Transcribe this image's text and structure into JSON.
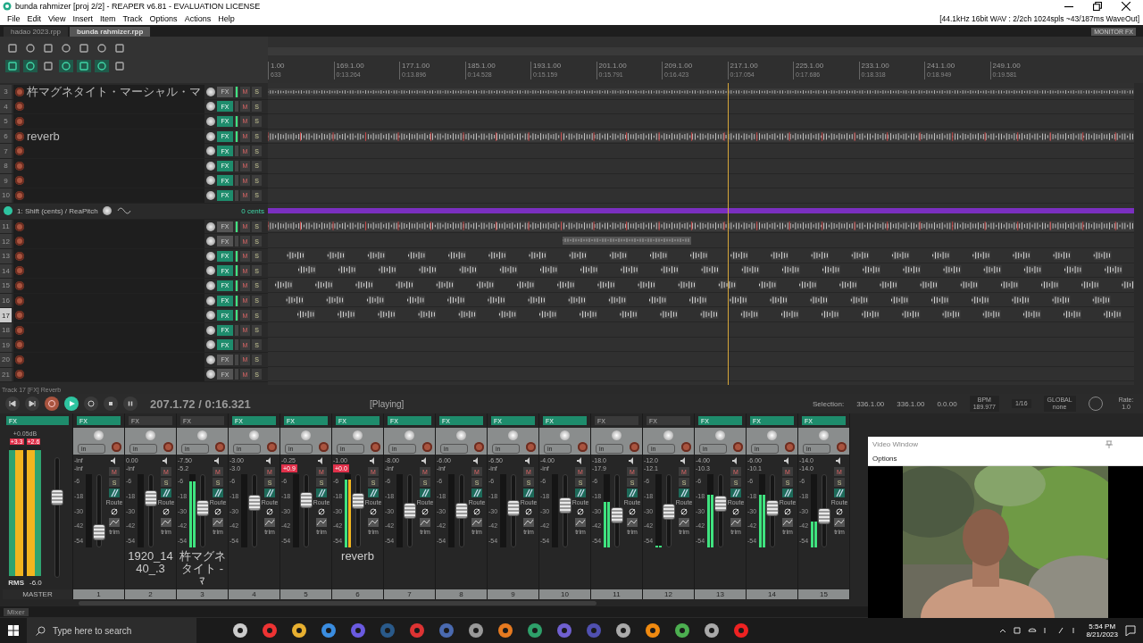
{
  "window": {
    "title": "bunda rahmizer [proj 2/2] - REAPER v6.81 - EVALUATION LICENSE",
    "audio_info": "[44.1kHz 16bit WAV : 2/2ch 1024spls ~43/187ms WaveOut]"
  },
  "menu": [
    "File",
    "Edit",
    "View",
    "Insert",
    "Item",
    "Track",
    "Options",
    "Actions",
    "Help"
  ],
  "project_tabs": [
    {
      "label": "hadao 2023.rpp",
      "selected": false
    },
    {
      "label": "bunda rahmizer.rpp",
      "selected": true
    }
  ],
  "monitor_fx": "MONITOR FX",
  "ruler": [
    {
      "bar": "1.00",
      "time": "633"
    },
    {
      "bar": "169.1.00",
      "time": "0:13.264"
    },
    {
      "bar": "177.1.00",
      "time": "0:13.896"
    },
    {
      "bar": "185.1.00",
      "time": "0:14.528"
    },
    {
      "bar": "193.1.00",
      "time": "0:15.159"
    },
    {
      "bar": "201.1.00",
      "time": "0:15.791"
    },
    {
      "bar": "209.1.00",
      "time": "0:16.423"
    },
    {
      "bar": "217.1.00",
      "time": "0:17.054"
    },
    {
      "bar": "225.1.00",
      "time": "0:17.686"
    },
    {
      "bar": "233.1.00",
      "time": "0:18.318"
    },
    {
      "bar": "241.1.00",
      "time": "0:18.949"
    },
    {
      "bar": "249.1.00",
      "time": "0:19.581"
    }
  ],
  "tracks": [
    {
      "kind": "track",
      "number": "3",
      "name": "杵マグネタイト・マーシャル・マ",
      "fx": "FX",
      "mute": "M",
      "solo": "S",
      "fx_on": false,
      "meter_on": true,
      "selected": false,
      "lane": {
        "kind": "thin"
      }
    },
    {
      "kind": "track",
      "number": "4",
      "fx": "FX",
      "mute": "M",
      "solo": "S",
      "fx_on": true,
      "meter_on": false,
      "selected": false
    },
    {
      "kind": "track",
      "number": "5",
      "fx": "FX",
      "mute": "M",
      "solo": "S",
      "fx_on": true,
      "meter_on": true,
      "selected": false
    },
    {
      "kind": "track",
      "number": "6",
      "name": "reverb",
      "fx": "FX",
      "mute": "M",
      "solo": "S",
      "fx_on": true,
      "meter_on": true,
      "selected": false,
      "lane": {
        "kind": "full"
      }
    },
    {
      "kind": "track",
      "number": "7",
      "fx": "FX",
      "mute": "M",
      "solo": "S",
      "fx_on": true,
      "meter_on": false,
      "selected": false
    },
    {
      "kind": "track",
      "number": "8",
      "fx": "FX",
      "mute": "M",
      "solo": "S",
      "fx_on": true,
      "meter_on": false,
      "selected": false
    },
    {
      "kind": "track",
      "number": "9",
      "fx": "FX",
      "mute": "M",
      "solo": "S",
      "fx_on": true,
      "meter_on": false,
      "selected": false
    },
    {
      "kind": "track",
      "number": "10",
      "fx": "FX",
      "mute": "M",
      "solo": "S",
      "fx_on": true,
      "meter_on": false,
      "selected": false
    },
    {
      "kind": "envelope",
      "name": "1: Shift (cents) / ReaPitch",
      "value": "0 cents"
    },
    {
      "kind": "track",
      "number": "11",
      "fx": "FX",
      "mute": "M",
      "solo": "S",
      "fx_on": false,
      "meter_on": true,
      "selected": false,
      "lane": {
        "kind": "full"
      }
    },
    {
      "kind": "track",
      "number": "12",
      "fx": "FX",
      "mute": "M",
      "solo": "S",
      "fx_on": false,
      "meter_on": false,
      "selected": false,
      "lane": {
        "kind": "block"
      }
    },
    {
      "kind": "track",
      "number": "13",
      "fx": "FX",
      "mute": "M",
      "solo": "S",
      "fx_on": true,
      "meter_on": true,
      "selected": false,
      "lane": {
        "kind": "pattern"
      }
    },
    {
      "kind": "track",
      "number": "14",
      "fx": "FX",
      "mute": "M",
      "solo": "S",
      "fx_on": true,
      "meter_on": true,
      "selected": false,
      "lane": {
        "kind": "pattern"
      }
    },
    {
      "kind": "track",
      "number": "15",
      "fx": "FX",
      "mute": "M",
      "solo": "S",
      "fx_on": true,
      "meter_on": true,
      "selected": false,
      "lane": {
        "kind": "pattern"
      }
    },
    {
      "kind": "track",
      "number": "16",
      "fx": "FX",
      "mute": "M",
      "solo": "S",
      "fx_on": true,
      "meter_on": true,
      "selected": false,
      "lane": {
        "kind": "pattern"
      }
    },
    {
      "kind": "track",
      "number": "17",
      "fx": "FX",
      "mute": "M",
      "solo": "S",
      "fx_on": true,
      "meter_on": true,
      "selected": true,
      "lane": {
        "kind": "pattern"
      }
    },
    {
      "kind": "track",
      "number": "18",
      "fx": "FX",
      "mute": "M",
      "solo": "S",
      "fx_on": true,
      "meter_on": false,
      "selected": false
    },
    {
      "kind": "track",
      "number": "19",
      "fx": "FX",
      "mute": "M",
      "solo": "S",
      "fx_on": true,
      "meter_on": false,
      "selected": false
    },
    {
      "kind": "track",
      "number": "20",
      "fx": "FX",
      "mute": "M",
      "solo": "S",
      "fx_on": false,
      "meter_on": false,
      "selected": false
    },
    {
      "kind": "track",
      "number": "21",
      "fx": "FX",
      "mute": "M",
      "solo": "S",
      "fx_on": false,
      "meter_on": false,
      "selected": false
    }
  ],
  "status_line": "Track 17 [FX] Reverb",
  "transport": {
    "position": "207.1.72 / 0:16.321",
    "state": "[Playing]",
    "playing": true,
    "selection_label": "Selection:",
    "selection_start": "336.1.00",
    "selection_end": "336.1.00",
    "selection_length": "0.0.00",
    "bpm_label": "BPM",
    "bpm": "189.977",
    "grid": "1/16",
    "global_label": "GLOBAL",
    "global_value": "none",
    "rate_label": "Rate:",
    "rate": "1.0"
  },
  "mixer": {
    "master": {
      "fx": "FX",
      "volume": "+0.05dB",
      "peak_left": "+3.3",
      "peak_right": "+2.6",
      "mode": "RMS",
      "reading": "-6.0",
      "name": "MASTER",
      "meter": {
        "level": 0.97
      },
      "fader": {
        "level": 0.7
      }
    },
    "channels": [
      {
        "number": "1",
        "volume": "-inf",
        "peak": "-inf",
        "clip": false,
        "fx_on": true,
        "labels": {
          "fx": "FX",
          "input": "in",
          "mute": "M",
          "solo": "S",
          "route": "Route",
          "trim": "trim"
        },
        "scale": [
          "-6",
          "-18",
          "-30",
          "-42",
          "-54"
        ],
        "fader": {
          "level": 0.12
        }
      },
      {
        "number": "2",
        "name": "1920_1440_.3",
        "volume": "0.00",
        "peak": "-inf",
        "clip": false,
        "fx_on": false,
        "labels": {
          "fx": "FX",
          "input": "in",
          "mute": "M",
          "solo": "S",
          "route": "Route",
          "trim": "trim"
        },
        "scale": [
          "-6",
          "-18",
          "-30",
          "-42",
          "-54"
        ],
        "fader": {
          "level": 0.72
        }
      },
      {
        "number": "3",
        "name": "杵マグネタイト - ﾏ",
        "volume": "-7.50",
        "peak": "-5.2",
        "clip": false,
        "fx_on": false,
        "labels": {
          "fx": "FX",
          "input": "in",
          "mute": "M",
          "solo": "S",
          "route": "Route",
          "trim": "trim"
        },
        "scale": [
          "-6",
          "-18",
          "-30",
          "-42",
          "-54"
        ],
        "meter": {
          "level": 0.9
        },
        "fader": {
          "level": 0.55
        }
      },
      {
        "number": "4",
        "volume": "-3.00",
        "peak": "-3.0",
        "clip": false,
        "fx_on": true,
        "labels": {
          "fx": "FX",
          "input": "in",
          "mute": "M",
          "solo": "S",
          "route": "Route",
          "trim": "trim"
        },
        "scale": [
          "-6",
          "-18",
          "-30",
          "-42",
          "-54"
        ],
        "fader": {
          "level": 0.64
        }
      },
      {
        "number": "5",
        "volume": "-0.25",
        "peak": "+0.9",
        "clip": true,
        "fx_on": true,
        "labels": {
          "fx": "FX",
          "input": "in",
          "mute": "M",
          "solo": "S",
          "route": "Route",
          "trim": "trim"
        },
        "scale": [
          "-6",
          "-18",
          "-30",
          "-42",
          "-54"
        ],
        "fader": {
          "level": 0.7
        }
      },
      {
        "number": "6",
        "name": "reverb",
        "volume": "-1.00",
        "peak": "+0.0",
        "clip": true,
        "fx_on": true,
        "labels": {
          "fx": "FX",
          "input": "in",
          "mute": "M",
          "solo": "S",
          "route": "Route",
          "trim": "trim"
        },
        "scale": [
          "-6",
          "-18",
          "-30",
          "-42",
          "-54"
        ],
        "meter": {
          "level": 0.93
        },
        "fader": {
          "level": 0.67
        }
      },
      {
        "number": "7",
        "volume": "-8.00",
        "peak": "-inf",
        "clip": false,
        "fx_on": true,
        "labels": {
          "fx": "FX",
          "input": "in",
          "mute": "M",
          "solo": "S",
          "route": "Route",
          "trim": "trim"
        },
        "scale": [
          "-6",
          "-18",
          "-30",
          "-42",
          "-54"
        ],
        "fader": {
          "level": 0.5
        }
      },
      {
        "number": "8",
        "volume": "-6.00",
        "peak": "-inf",
        "clip": false,
        "fx_on": true,
        "labels": {
          "fx": "FX",
          "input": "in",
          "mute": "M",
          "solo": "S",
          "route": "Route",
          "trim": "trim"
        },
        "scale": [
          "-6",
          "-18",
          "-30",
          "-42",
          "-54"
        ],
        "fader": {
          "level": 0.5
        }
      },
      {
        "number": "9",
        "volume": "-6.50",
        "peak": "-inf",
        "clip": false,
        "fx_on": true,
        "labels": {
          "fx": "FX",
          "input": "in",
          "mute": "M",
          "solo": "S",
          "route": "Route",
          "trim": "trim"
        },
        "scale": [
          "-6",
          "-18",
          "-30",
          "-42",
          "-54"
        ],
        "fader": {
          "level": 0.55
        }
      },
      {
        "number": "10",
        "volume": "-4.00",
        "peak": "-inf",
        "clip": false,
        "fx_on": true,
        "labels": {
          "fx": "FX",
          "input": "in",
          "mute": "M",
          "solo": "S",
          "route": "Route",
          "trim": "trim"
        },
        "scale": [
          "-6",
          "-18",
          "-30",
          "-42",
          "-54"
        ],
        "fader": {
          "level": 0.6
        }
      },
      {
        "number": "11",
        "volume": "-18.0",
        "peak": "-17.9",
        "clip": false,
        "fx_on": false,
        "labels": {
          "fx": "FX",
          "input": "in",
          "mute": "M",
          "solo": "S",
          "route": "Route",
          "trim": "trim"
        },
        "scale": [
          "-6",
          "-18",
          "-30",
          "-42",
          "-54"
        ],
        "meter": {
          "level": 0.62
        },
        "fader": {
          "level": 0.42
        }
      },
      {
        "number": "12",
        "volume": "-12.0",
        "peak": "-12.1",
        "clip": false,
        "fx_on": false,
        "labels": {
          "fx": "FX",
          "input": "in",
          "mute": "M",
          "solo": "S",
          "route": "Route",
          "trim": "trim"
        },
        "scale": [
          "-6",
          "-18",
          "-30",
          "-42",
          "-54"
        ],
        "meter": {
          "level": 0.03
        },
        "fader": {
          "level": 0.48
        }
      },
      {
        "number": "13",
        "volume": "-4.00",
        "peak": "-10.3",
        "clip": false,
        "fx_on": true,
        "labels": {
          "fx": "FX",
          "input": "in",
          "mute": "M",
          "solo": "S",
          "route": "Route",
          "trim": "trim"
        },
        "scale": [
          "-6",
          "-18",
          "-30",
          "-42",
          "-54"
        ],
        "meter": {
          "level": 0.72
        },
        "fader": {
          "level": 0.63
        }
      },
      {
        "number": "14",
        "volume": "-6.00",
        "peak": "-10.1",
        "clip": false,
        "fx_on": true,
        "labels": {
          "fx": "FX",
          "input": "in",
          "mute": "M",
          "solo": "S",
          "route": "Route",
          "trim": "trim"
        },
        "scale": [
          "-6",
          "-18",
          "-30",
          "-42",
          "-54"
        ],
        "meter": {
          "level": 0.72
        },
        "fader": {
          "level": 0.55
        }
      },
      {
        "number": "15",
        "volume": "-14.0",
        "peak": "-14.0",
        "clip": false,
        "fx_on": true,
        "labels": {
          "fx": "FX",
          "input": "in",
          "mute": "M",
          "solo": "S",
          "route": "Route",
          "trim": "trim"
        },
        "scale": [
          "-6",
          "-18",
          "-30",
          "-42",
          "-54"
        ],
        "meter": {
          "level": 0.35
        },
        "fader": {
          "level": 0.4
        }
      }
    ],
    "tab": "Mixer"
  },
  "video_window": {
    "title": "Video Window",
    "menu": "Options"
  },
  "taskbar": {
    "search_placeholder": "Type here to search",
    "time": "5:54 PM",
    "date": "8/21/2023"
  }
}
